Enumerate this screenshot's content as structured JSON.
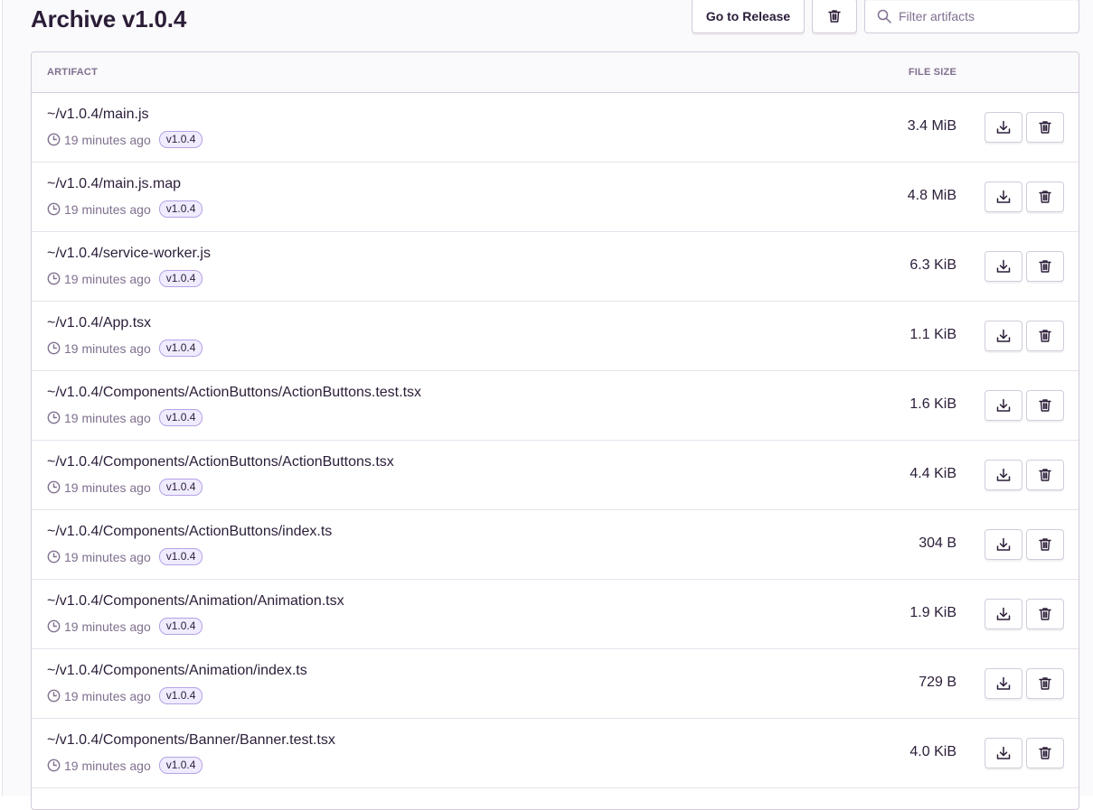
{
  "page": {
    "title": "Archive v1.0.4",
    "go_to_release_label": "Go to Release",
    "search_placeholder": "Filter artifacts"
  },
  "table": {
    "headers": {
      "artifact": "ARTIFACT",
      "file_size": "FILE SIZE"
    },
    "rows": [
      {
        "name": "~/v1.0.4/main.js",
        "time": "19 minutes ago",
        "version": "v1.0.4",
        "size": "3.4 MiB"
      },
      {
        "name": "~/v1.0.4/main.js.map",
        "time": "19 minutes ago",
        "version": "v1.0.4",
        "size": "4.8 MiB"
      },
      {
        "name": "~/v1.0.4/service-worker.js",
        "time": "19 minutes ago",
        "version": "v1.0.4",
        "size": "6.3 KiB"
      },
      {
        "name": "~/v1.0.4/App.tsx",
        "time": "19 minutes ago",
        "version": "v1.0.4",
        "size": "1.1 KiB"
      },
      {
        "name": "~/v1.0.4/Components/ActionButtons/ActionButtons.test.tsx",
        "time": "19 minutes ago",
        "version": "v1.0.4",
        "size": "1.6 KiB"
      },
      {
        "name": "~/v1.0.4/Components/ActionButtons/ActionButtons.tsx",
        "time": "19 minutes ago",
        "version": "v1.0.4",
        "size": "4.4 KiB"
      },
      {
        "name": "~/v1.0.4/Components/ActionButtons/index.ts",
        "time": "19 minutes ago",
        "version": "v1.0.4",
        "size": "304 B"
      },
      {
        "name": "~/v1.0.4/Components/Animation/Animation.tsx",
        "time": "19 minutes ago",
        "version": "v1.0.4",
        "size": "1.9 KiB"
      },
      {
        "name": "~/v1.0.4/Components/Animation/index.ts",
        "time": "19 minutes ago",
        "version": "v1.0.4",
        "size": "729 B"
      },
      {
        "name": "~/v1.0.4/Components/Banner/Banner.test.tsx",
        "time": "19 minutes ago",
        "version": "v1.0.4",
        "size": "4.0 KiB"
      }
    ]
  },
  "icons": {
    "search": "search-icon",
    "trash": "trash-icon",
    "download": "download-icon",
    "clock": "clock-icon"
  },
  "colors": {
    "text": "#2b1d38",
    "muted": "#80708f",
    "border": "#d3cbda",
    "badge_bg": "#f0ecff",
    "badge_border": "#b5a2e4"
  }
}
